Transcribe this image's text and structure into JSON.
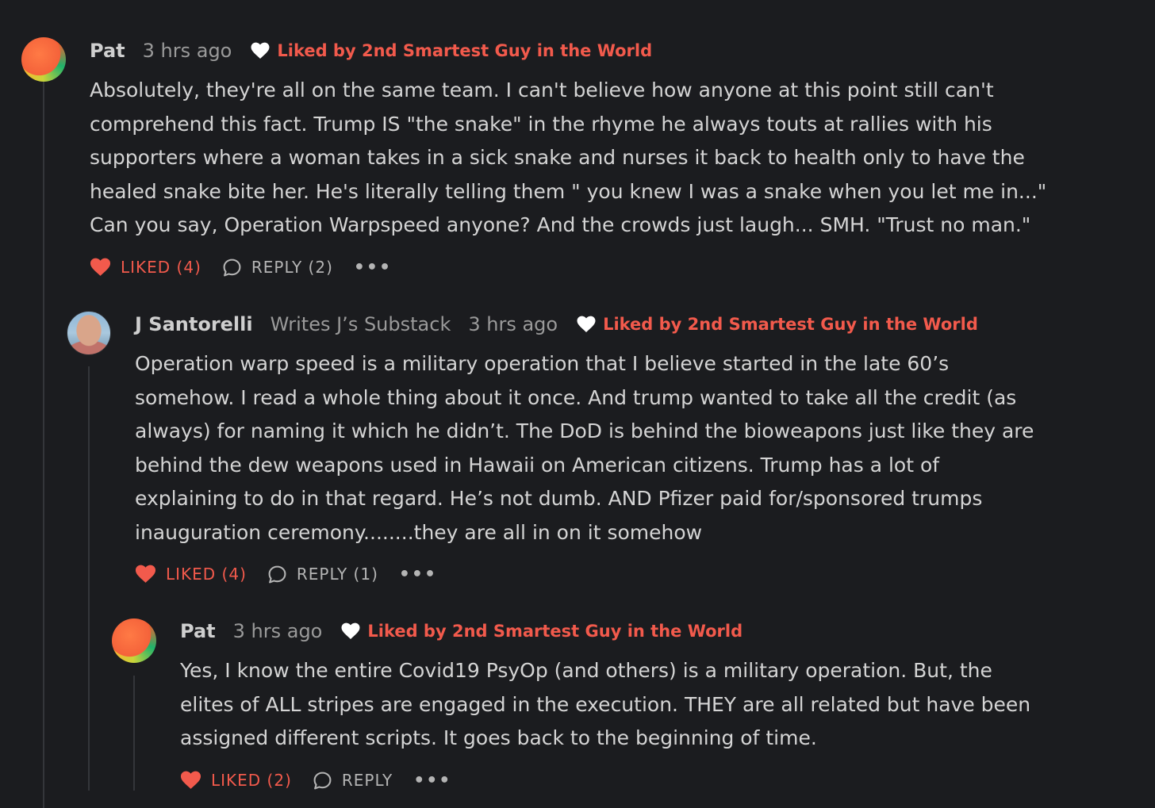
{
  "colors": {
    "background": "#1b1c1f",
    "accent": "#f25a4c",
    "text": "#d4d4d4",
    "muted": "#9a9a9a"
  },
  "comments": [
    {
      "author": "Pat",
      "publication": "",
      "time": "3 hrs ago",
      "liked_by": "Liked by 2nd Smartest Guy in the World",
      "lines": [
        "Absolutely, they're all on the same team. I can't believe how anyone at this point still can't",
        "comprehend this fact. Trump IS \"the snake\" in the rhyme he always touts at rallies with his",
        "supporters where a woman takes in a sick snake and nurses it back to health only to have the",
        "healed snake bite her. He's literally telling them \" you knew I was a snake when you let me in...\"",
        "Can you say, Operation Warpspeed anyone? And the crowds just laugh... SMH. \"Trust no man.\""
      ],
      "liked_label": "LIKED (4)",
      "reply_label": "REPLY (2)",
      "more_label": "•••",
      "avatar_icon": "gradient-avatar"
    },
    {
      "author": "J Santorelli",
      "publication": "Writes J’s Substack",
      "time": "3 hrs ago",
      "liked_by": "Liked by 2nd Smartest Guy in the World",
      "lines": [
        "Operation warp speed is a military operation that I believe started in the late 60’s",
        "somehow. I read a whole thing about it once. And trump wanted to take all the credit (as",
        "always) for naming it which he didn’t. The DoD is behind the bioweapons just like they are",
        "behind the dew weapons used in Hawaii on American citizens. Trump has a lot of",
        "explaining to do in that regard. He’s not dumb. AND Pfizer paid for/sponsored trumps",
        "inauguration ceremony........they are all in on it somehow"
      ],
      "liked_label": "LIKED (4)",
      "reply_label": "REPLY (1)",
      "more_label": "•••",
      "avatar_icon": "photo-avatar"
    },
    {
      "author": "Pat",
      "publication": "",
      "time": "3 hrs ago",
      "liked_by": "Liked by 2nd Smartest Guy in the World",
      "lines": [
        "Yes, I know the entire Covid19 PsyOp (and others) is a military operation. But, the",
        "elites of ALL stripes are engaged in the execution. THEY are all related but have been",
        "assigned different scripts. It goes back to the beginning of time."
      ],
      "liked_label": "LIKED (2)",
      "reply_label": "REPLY",
      "more_label": "•••",
      "avatar_icon": "gradient-avatar"
    }
  ]
}
